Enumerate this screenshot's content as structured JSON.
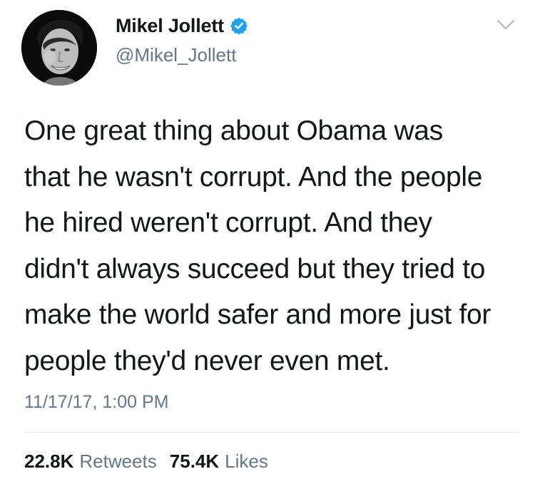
{
  "author": {
    "name": "Mikel Jollett",
    "handle": "@Mikel_Jollett",
    "verified": true,
    "verified_color": "#1da1f2"
  },
  "tweet": {
    "lines": [
      "One great thing about Obama was",
      "that he wasn't corrupt. And the people",
      "he hired weren't corrupt. And they",
      "didn't always succeed but they tried to",
      "make the world safer and more just for",
      "people they'd never even met."
    ],
    "timestamp": "11/17/17, 1:00 PM"
  },
  "stats": {
    "retweets_count": "22.8K",
    "retweets_label": "Retweets",
    "likes_count": "75.4K",
    "likes_label": "Likes"
  },
  "icons": {
    "verified": "verified-badge-icon",
    "menu": "chevron-down-icon"
  },
  "colors": {
    "text": "#14171a",
    "secondary": "#657786",
    "divider": "#e1e8ed"
  }
}
